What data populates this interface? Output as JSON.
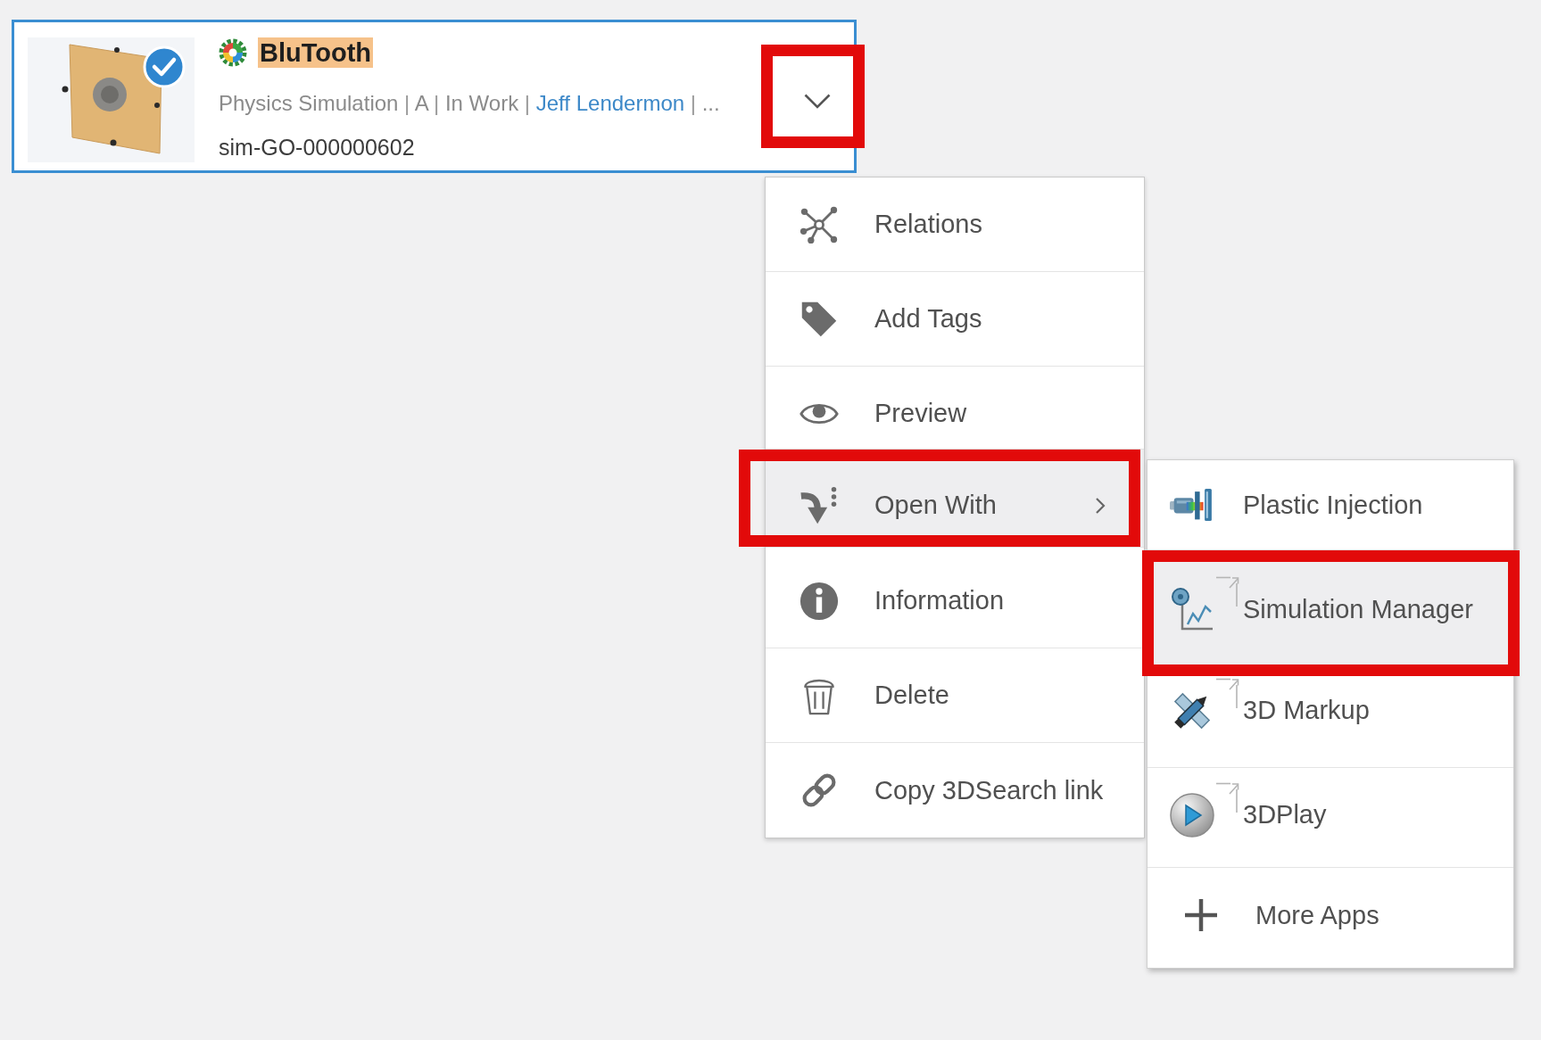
{
  "card": {
    "selected": true,
    "title": "BluTooth",
    "title_highlighted": true,
    "meta": [
      {
        "kind": "text",
        "text": "Physics Simulation"
      },
      {
        "kind": "separator",
        "text": "|"
      },
      {
        "kind": "text",
        "text": "A"
      },
      {
        "kind": "separator",
        "text": "|"
      },
      {
        "kind": "text",
        "text": "In Work"
      },
      {
        "kind": "separator",
        "text": "|"
      },
      {
        "kind": "link",
        "text": "Jeff Lendermon"
      },
      {
        "kind": "separator",
        "text": "|"
      },
      {
        "kind": "text",
        "text": "..."
      }
    ],
    "id": "sim-GO-000000602",
    "menu_button": {
      "annotated": true
    }
  },
  "menu": {
    "items": [
      {
        "label": "Relations",
        "selected": false,
        "has_submenu": false,
        "annotated": false
      },
      {
        "label": "Add Tags",
        "selected": false,
        "has_submenu": false,
        "annotated": false
      },
      {
        "label": "Preview",
        "selected": false,
        "has_submenu": false,
        "annotated": false
      },
      {
        "label": "Open With",
        "selected": true,
        "has_submenu": true,
        "annotated": true
      },
      {
        "label": "Information",
        "selected": false,
        "has_submenu": false,
        "annotated": false
      },
      {
        "label": "Delete",
        "selected": false,
        "has_submenu": false,
        "annotated": false
      },
      {
        "label": "Copy 3DSearch link",
        "selected": false,
        "has_submenu": false,
        "annotated": false
      }
    ]
  },
  "submenu": {
    "items": [
      {
        "kind": "app",
        "label": "Plastic Injection",
        "selected": false,
        "annotated": false,
        "corner_arrow": false
      },
      {
        "kind": "app",
        "label": "Simulation Manager",
        "selected": true,
        "annotated": true,
        "corner_arrow": true
      },
      {
        "kind": "app",
        "label": "3D Markup",
        "selected": false,
        "annotated": false,
        "corner_arrow": true
      },
      {
        "kind": "app",
        "label": "3DPlay",
        "selected": false,
        "annotated": false,
        "corner_arrow": true
      },
      {
        "kind": "action",
        "label": "More Apps",
        "selected": false,
        "annotated": false,
        "corner_arrow": false
      }
    ]
  }
}
